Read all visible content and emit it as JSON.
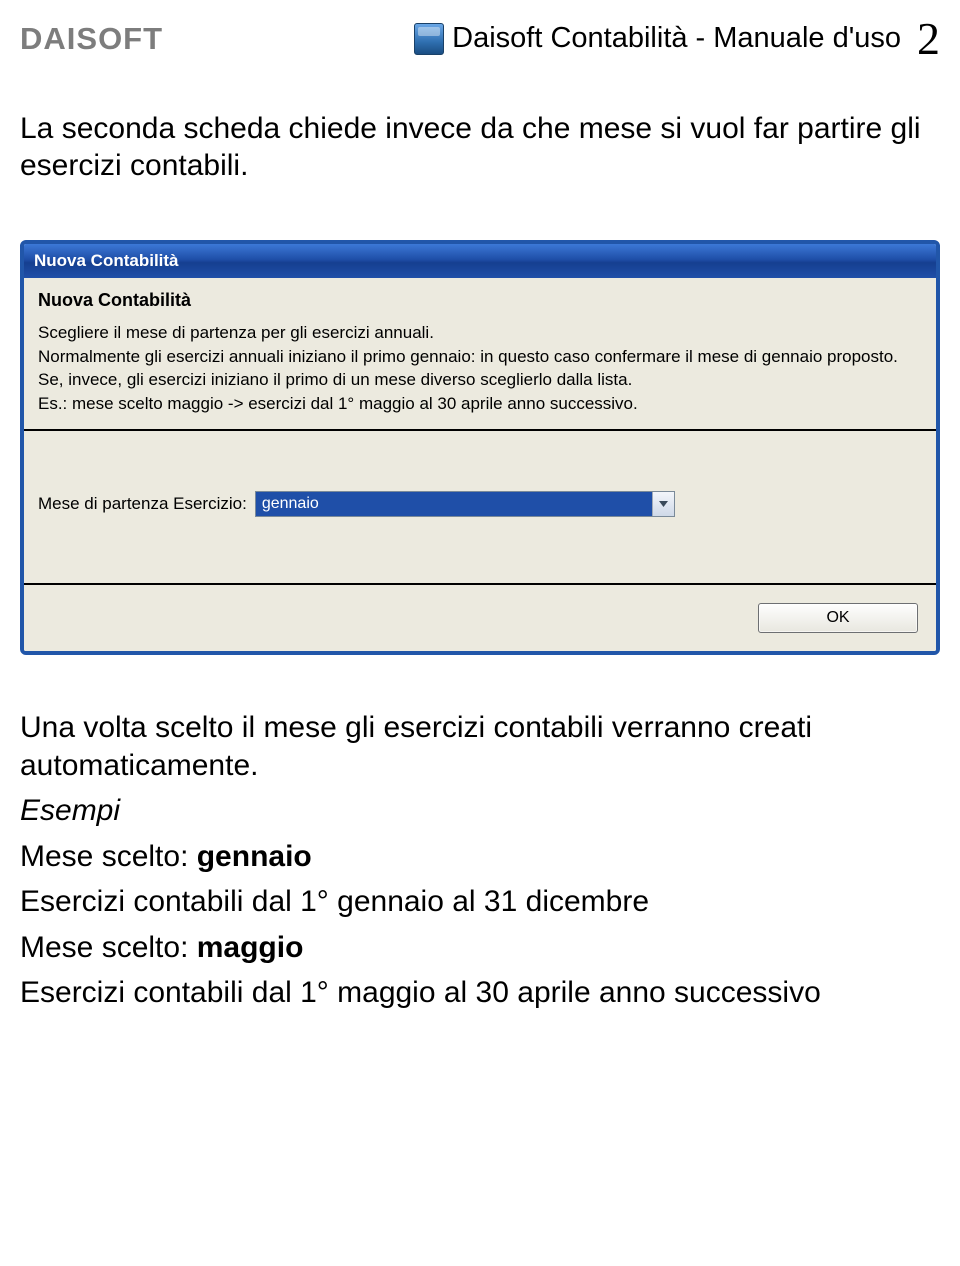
{
  "header": {
    "brand": "DAISOFT",
    "title": "Daisoft Contabilità - Manuale d'uso",
    "page_number": "2"
  },
  "intro": {
    "text": "La seconda scheda chiede invece da che mese si vuol far partire gli esercizi contabili."
  },
  "dialog": {
    "titlebar": "Nuova Contabilità",
    "heading": "Nuova Contabilità",
    "line1": "Scegliere il mese di partenza per gli esercizi annuali.",
    "line2": "Normalmente gli esercizi annuali iniziano il primo gennaio: in questo caso confermare il mese di gennaio proposto.",
    "line3": "Se, invece, gli esercizi iniziano il primo di un mese diverso sceglierlo dalla lista.",
    "line4": "Es.: mese scelto maggio -> esercizi dal 1° maggio al 30 aprile anno successivo.",
    "field_label": "Mese di partenza Esercizio:",
    "field_value": "gennaio",
    "ok_label": "OK"
  },
  "post": {
    "p1": "Una volta scelto il mese gli esercizi contabili verranno creati automaticamente.",
    "esempi_label": "Esempi",
    "mese_scelto_label": "Mese scelto: ",
    "gennaio": "gennaio",
    "line_gennaio": "Esercizi contabili dal 1° gennaio al 31 dicembre",
    "maggio": "maggio",
    "line_maggio": "Esercizi contabili dal 1° maggio al 30 aprile anno successivo"
  }
}
